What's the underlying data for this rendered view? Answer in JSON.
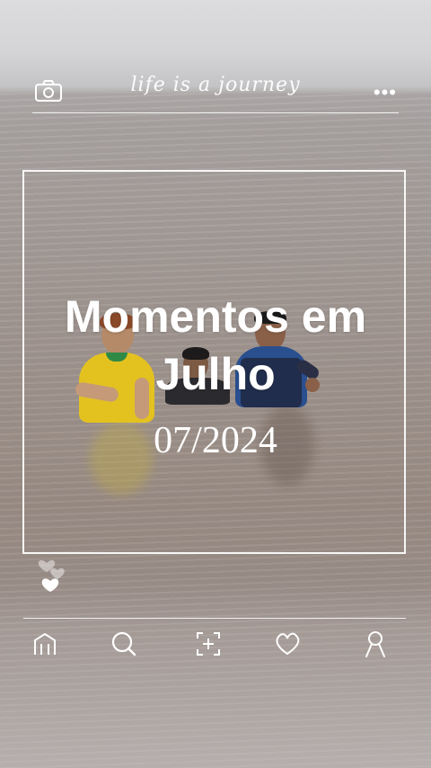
{
  "header": {
    "brand_text": "life is a journey",
    "left_icon": "camera-icon",
    "right_icon": "more-dots-icon",
    "more_glyph": "•••"
  },
  "card": {
    "title": "Momentos em Julho",
    "date": "07/2024"
  },
  "reactions": {
    "icon": "hearts-icon"
  },
  "nav": {
    "items": [
      {
        "icon": "home-icon"
      },
      {
        "icon": "search-icon"
      },
      {
        "icon": "add-post-icon"
      },
      {
        "icon": "heart-icon"
      },
      {
        "icon": "profile-icon"
      }
    ]
  },
  "colors": {
    "overlay": "#ffffff",
    "sky": "#d7d6d8",
    "water": "#a0958f",
    "jersey_yellow": "#e3c220",
    "jersey_blue": "#2a4f8f"
  }
}
